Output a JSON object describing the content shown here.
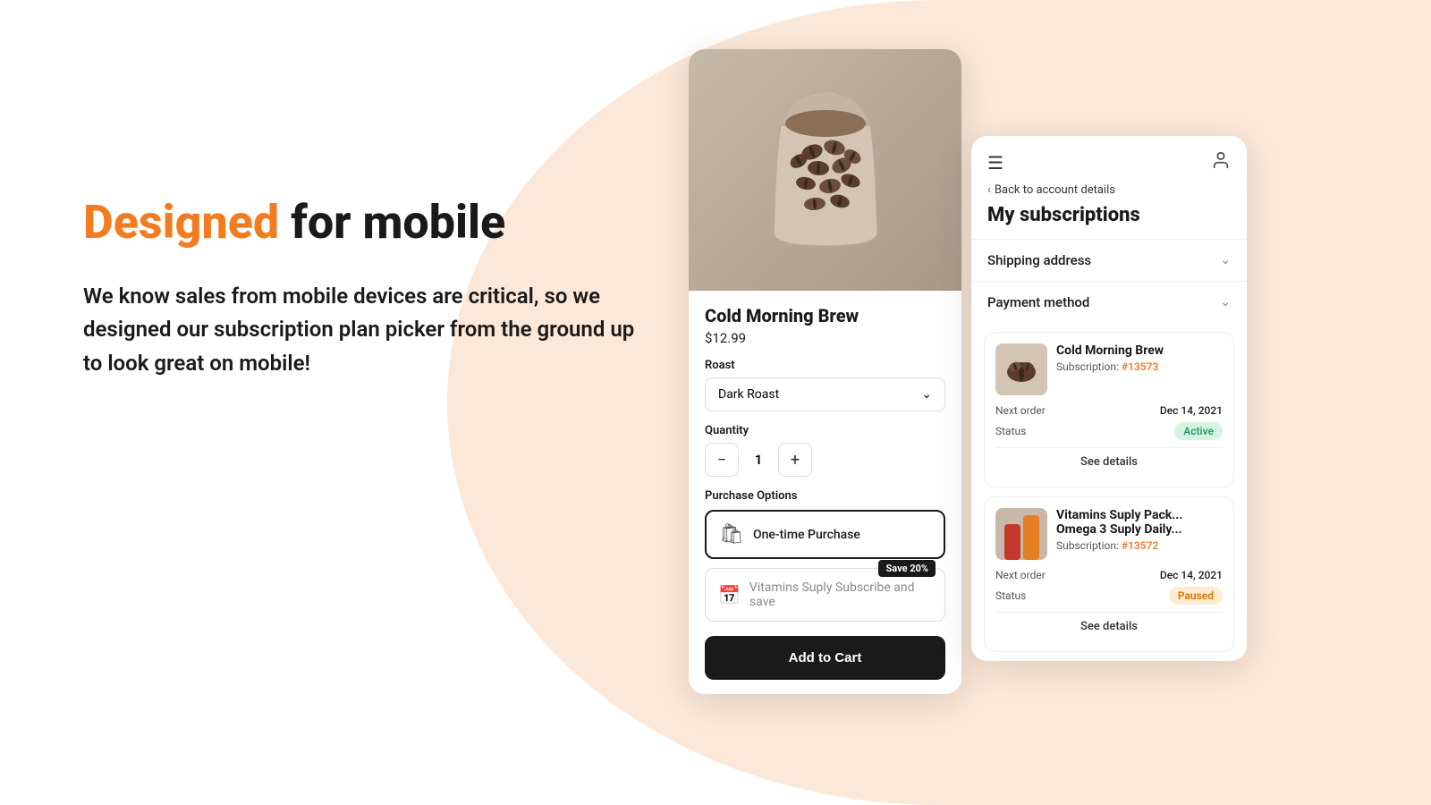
{
  "background": {
    "color": "#fde8d6"
  },
  "hero": {
    "headline_part1": "Designed",
    "headline_part2": " for mobile",
    "subtext": "We know sales from mobile devices are critical, so we designed our subscription plan picker from the ground up to look great on mobile!"
  },
  "product_card": {
    "product_name": "Cold Morning Brew",
    "price": "$12.99",
    "roast_label": "Roast",
    "roast_value": "Dark Roast",
    "quantity_label": "Quantity",
    "quantity_value": "1",
    "purchase_options_label": "Purchase Options",
    "option_one_time": "One-time Purchase",
    "option_subscribe_text": "Vitamins Suply Subscribe and save",
    "save_badge": "Save 20%",
    "add_to_cart": "Add to Cart"
  },
  "subscription_panel": {
    "menu_icon": "☰",
    "user_icon": "👤",
    "back_link": "Back to account details",
    "title": "My subscriptions",
    "accordion": [
      {
        "label": "Shipping address"
      },
      {
        "label": "Payment method"
      }
    ],
    "subscriptions": [
      {
        "name": "Cold Morning Brew",
        "subscription_label": "Subscription:",
        "subscription_id": "#13573",
        "next_order_label": "Next order",
        "next_order_value": "Dec 14, 2021",
        "status_label": "Status",
        "status_value": "Active",
        "status_type": "active",
        "see_details": "See details"
      },
      {
        "name": "Vitamins Suply Pack...",
        "name_line2": "Omega 3 Suply Daily...",
        "subscription_label": "Subscription:",
        "subscription_id": "#13572",
        "next_order_label": "Next order",
        "next_order_value": "Dec 14, 2021",
        "status_label": "Status",
        "status_value": "Paused",
        "status_type": "paused",
        "see_details": "See details"
      }
    ]
  }
}
